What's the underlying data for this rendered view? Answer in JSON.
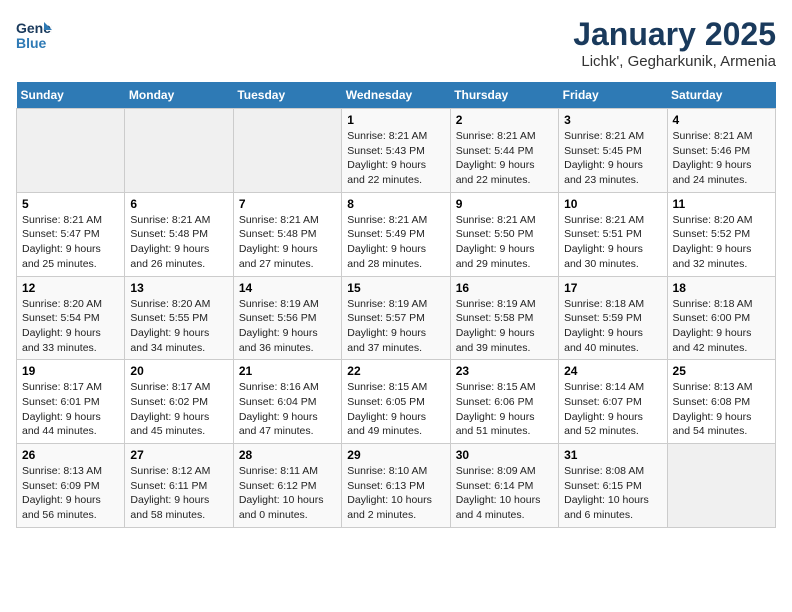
{
  "logo": {
    "line1": "General",
    "line2": "Blue"
  },
  "title": "January 2025",
  "subtitle": "Lichk', Gegharkunik, Armenia",
  "days_of_week": [
    "Sunday",
    "Monday",
    "Tuesday",
    "Wednesday",
    "Thursday",
    "Friday",
    "Saturday"
  ],
  "weeks": [
    [
      {
        "num": "",
        "sunrise": "",
        "sunset": "",
        "daylight": ""
      },
      {
        "num": "",
        "sunrise": "",
        "sunset": "",
        "daylight": ""
      },
      {
        "num": "",
        "sunrise": "",
        "sunset": "",
        "daylight": ""
      },
      {
        "num": "1",
        "sunrise": "Sunrise: 8:21 AM",
        "sunset": "Sunset: 5:43 PM",
        "daylight": "Daylight: 9 hours and 22 minutes."
      },
      {
        "num": "2",
        "sunrise": "Sunrise: 8:21 AM",
        "sunset": "Sunset: 5:44 PM",
        "daylight": "Daylight: 9 hours and 22 minutes."
      },
      {
        "num": "3",
        "sunrise": "Sunrise: 8:21 AM",
        "sunset": "Sunset: 5:45 PM",
        "daylight": "Daylight: 9 hours and 23 minutes."
      },
      {
        "num": "4",
        "sunrise": "Sunrise: 8:21 AM",
        "sunset": "Sunset: 5:46 PM",
        "daylight": "Daylight: 9 hours and 24 minutes."
      }
    ],
    [
      {
        "num": "5",
        "sunrise": "Sunrise: 8:21 AM",
        "sunset": "Sunset: 5:47 PM",
        "daylight": "Daylight: 9 hours and 25 minutes."
      },
      {
        "num": "6",
        "sunrise": "Sunrise: 8:21 AM",
        "sunset": "Sunset: 5:48 PM",
        "daylight": "Daylight: 9 hours and 26 minutes."
      },
      {
        "num": "7",
        "sunrise": "Sunrise: 8:21 AM",
        "sunset": "Sunset: 5:48 PM",
        "daylight": "Daylight: 9 hours and 27 minutes."
      },
      {
        "num": "8",
        "sunrise": "Sunrise: 8:21 AM",
        "sunset": "Sunset: 5:49 PM",
        "daylight": "Daylight: 9 hours and 28 minutes."
      },
      {
        "num": "9",
        "sunrise": "Sunrise: 8:21 AM",
        "sunset": "Sunset: 5:50 PM",
        "daylight": "Daylight: 9 hours and 29 minutes."
      },
      {
        "num": "10",
        "sunrise": "Sunrise: 8:21 AM",
        "sunset": "Sunset: 5:51 PM",
        "daylight": "Daylight: 9 hours and 30 minutes."
      },
      {
        "num": "11",
        "sunrise": "Sunrise: 8:20 AM",
        "sunset": "Sunset: 5:52 PM",
        "daylight": "Daylight: 9 hours and 32 minutes."
      }
    ],
    [
      {
        "num": "12",
        "sunrise": "Sunrise: 8:20 AM",
        "sunset": "Sunset: 5:54 PM",
        "daylight": "Daylight: 9 hours and 33 minutes."
      },
      {
        "num": "13",
        "sunrise": "Sunrise: 8:20 AM",
        "sunset": "Sunset: 5:55 PM",
        "daylight": "Daylight: 9 hours and 34 minutes."
      },
      {
        "num": "14",
        "sunrise": "Sunrise: 8:19 AM",
        "sunset": "Sunset: 5:56 PM",
        "daylight": "Daylight: 9 hours and 36 minutes."
      },
      {
        "num": "15",
        "sunrise": "Sunrise: 8:19 AM",
        "sunset": "Sunset: 5:57 PM",
        "daylight": "Daylight: 9 hours and 37 minutes."
      },
      {
        "num": "16",
        "sunrise": "Sunrise: 8:19 AM",
        "sunset": "Sunset: 5:58 PM",
        "daylight": "Daylight: 9 hours and 39 minutes."
      },
      {
        "num": "17",
        "sunrise": "Sunrise: 8:18 AM",
        "sunset": "Sunset: 5:59 PM",
        "daylight": "Daylight: 9 hours and 40 minutes."
      },
      {
        "num": "18",
        "sunrise": "Sunrise: 8:18 AM",
        "sunset": "Sunset: 6:00 PM",
        "daylight": "Daylight: 9 hours and 42 minutes."
      }
    ],
    [
      {
        "num": "19",
        "sunrise": "Sunrise: 8:17 AM",
        "sunset": "Sunset: 6:01 PM",
        "daylight": "Daylight: 9 hours and 44 minutes."
      },
      {
        "num": "20",
        "sunrise": "Sunrise: 8:17 AM",
        "sunset": "Sunset: 6:02 PM",
        "daylight": "Daylight: 9 hours and 45 minutes."
      },
      {
        "num": "21",
        "sunrise": "Sunrise: 8:16 AM",
        "sunset": "Sunset: 6:04 PM",
        "daylight": "Daylight: 9 hours and 47 minutes."
      },
      {
        "num": "22",
        "sunrise": "Sunrise: 8:15 AM",
        "sunset": "Sunset: 6:05 PM",
        "daylight": "Daylight: 9 hours and 49 minutes."
      },
      {
        "num": "23",
        "sunrise": "Sunrise: 8:15 AM",
        "sunset": "Sunset: 6:06 PM",
        "daylight": "Daylight: 9 hours and 51 minutes."
      },
      {
        "num": "24",
        "sunrise": "Sunrise: 8:14 AM",
        "sunset": "Sunset: 6:07 PM",
        "daylight": "Daylight: 9 hours and 52 minutes."
      },
      {
        "num": "25",
        "sunrise": "Sunrise: 8:13 AM",
        "sunset": "Sunset: 6:08 PM",
        "daylight": "Daylight: 9 hours and 54 minutes."
      }
    ],
    [
      {
        "num": "26",
        "sunrise": "Sunrise: 8:13 AM",
        "sunset": "Sunset: 6:09 PM",
        "daylight": "Daylight: 9 hours and 56 minutes."
      },
      {
        "num": "27",
        "sunrise": "Sunrise: 8:12 AM",
        "sunset": "Sunset: 6:11 PM",
        "daylight": "Daylight: 9 hours and 58 minutes."
      },
      {
        "num": "28",
        "sunrise": "Sunrise: 8:11 AM",
        "sunset": "Sunset: 6:12 PM",
        "daylight": "Daylight: 10 hours and 0 minutes."
      },
      {
        "num": "29",
        "sunrise": "Sunrise: 8:10 AM",
        "sunset": "Sunset: 6:13 PM",
        "daylight": "Daylight: 10 hours and 2 minutes."
      },
      {
        "num": "30",
        "sunrise": "Sunrise: 8:09 AM",
        "sunset": "Sunset: 6:14 PM",
        "daylight": "Daylight: 10 hours and 4 minutes."
      },
      {
        "num": "31",
        "sunrise": "Sunrise: 8:08 AM",
        "sunset": "Sunset: 6:15 PM",
        "daylight": "Daylight: 10 hours and 6 minutes."
      },
      {
        "num": "",
        "sunrise": "",
        "sunset": "",
        "daylight": ""
      }
    ]
  ]
}
